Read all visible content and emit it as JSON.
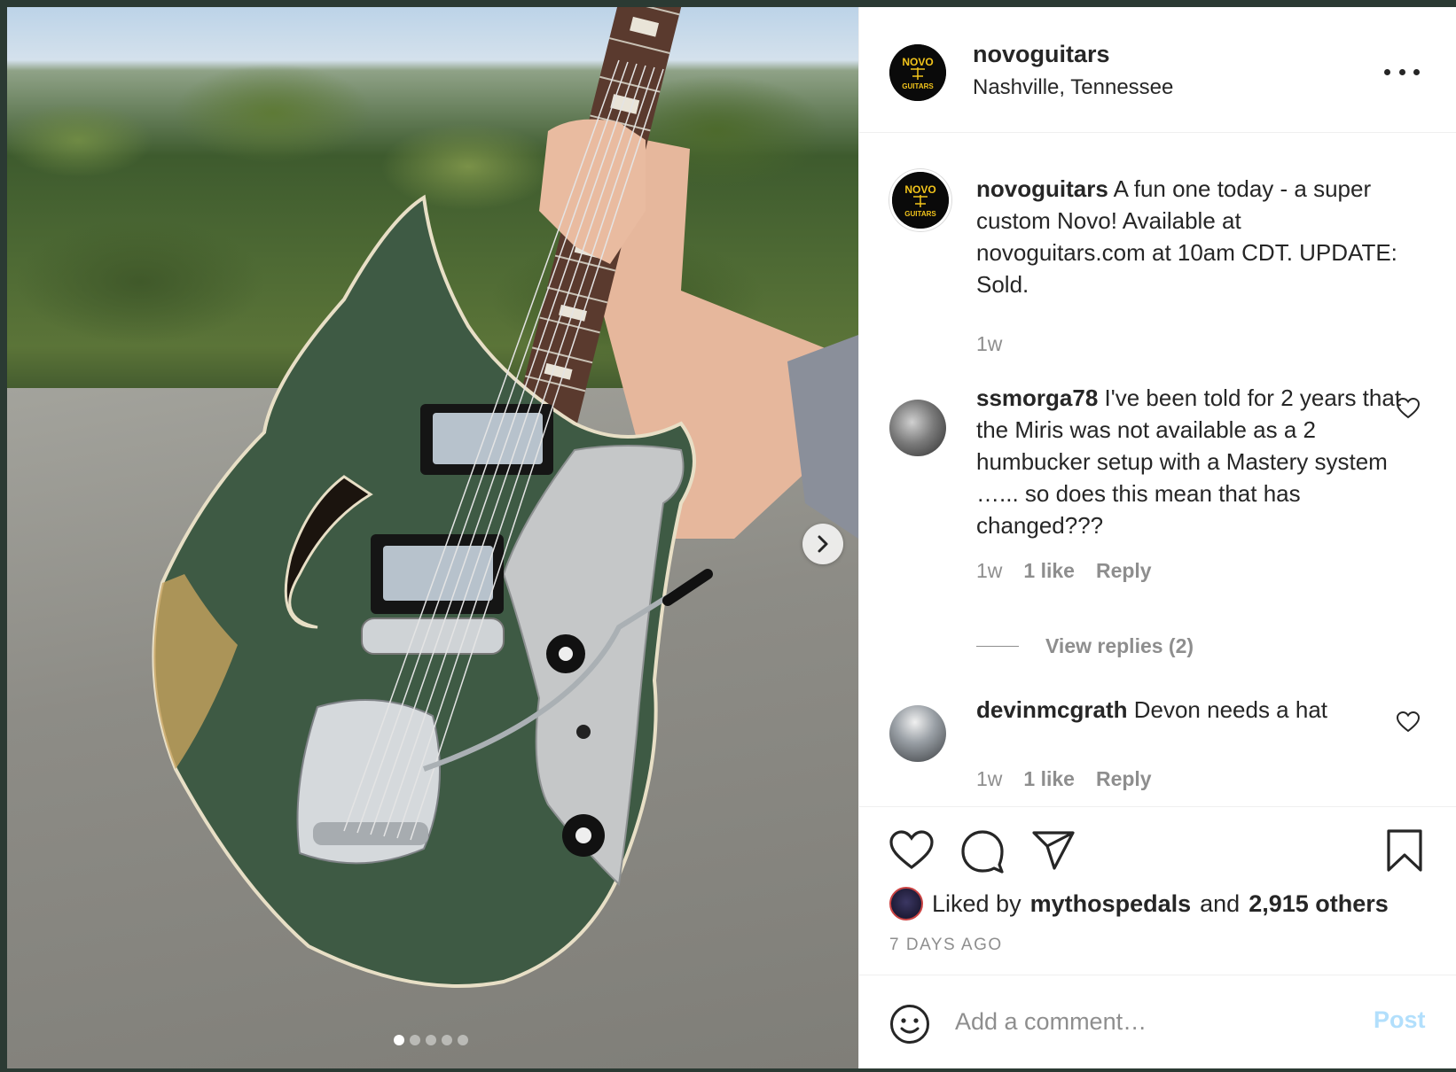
{
  "post": {
    "username": "novoguitars",
    "location": "Nashville, Tennessee",
    "logo_top": "NOVO",
    "logo_bottom": "GUITARS"
  },
  "caption": {
    "username": "novoguitars",
    "text": "A fun one today - a super custom Novo! Available at novoguitars.com at 10am CDT. UPDATE: Sold.",
    "age": "1w"
  },
  "comments": [
    {
      "username": "ssmorga78",
      "text": "I've been told for 2 years that the Miris was not available as a 2 humbucker setup with a Mastery system …... so does this mean that has changed???",
      "age": "1w",
      "likes": "1 like",
      "reply": "Reply",
      "view_replies": "View replies (2)"
    },
    {
      "username": "devinmcgrath",
      "text": "Devon needs a hat",
      "age": "1w",
      "likes": "1 like",
      "reply": "Reply"
    }
  ],
  "likes": {
    "prefix": "Liked by",
    "user": "mythospedals",
    "middle": "and",
    "others": "2,915 others"
  },
  "timestamp": "7 DAYS AGO",
  "add_comment": {
    "placeholder": "Add a comment…",
    "post_label": "Post"
  },
  "carousel": {
    "count": 5,
    "active": 1
  },
  "colors": {
    "link_disabled": "#b2dffc",
    "muted": "#8e8e8e",
    "text": "#262626",
    "guitar_body": "#3e5a44"
  }
}
